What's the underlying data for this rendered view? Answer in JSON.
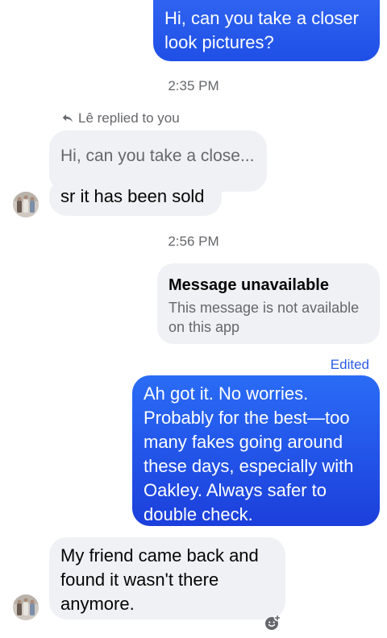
{
  "messages": {
    "outgoing_1": "Hi, can you take a closer look pictures?",
    "time_1": "2:35 PM",
    "replied_label": "Lê replied to you",
    "quoted_text": "Hi, can you take a close...",
    "incoming_1": "sr it has been sold",
    "time_2": "2:56 PM",
    "unavailable_title": "Message unavailable",
    "unavailable_body": "This message is not available on this app",
    "edited_label": "Edited",
    "outgoing_2": "Ah got it. No worries. Probably for the best—too many fakes going around these days, especially with Oakley. Always safer to double check.",
    "incoming_2": "My friend came back and found it wasn't there anymore."
  },
  "icons": {
    "reply": "reply-arrow-icon",
    "react": "add-reaction-icon",
    "avatar": "contact-avatar"
  },
  "colors": {
    "outgoing_bubble": "#1f4fe6",
    "incoming_bubble": "#f0f1f4",
    "meta_text": "#65676b",
    "edited": "#2b5ce6"
  }
}
